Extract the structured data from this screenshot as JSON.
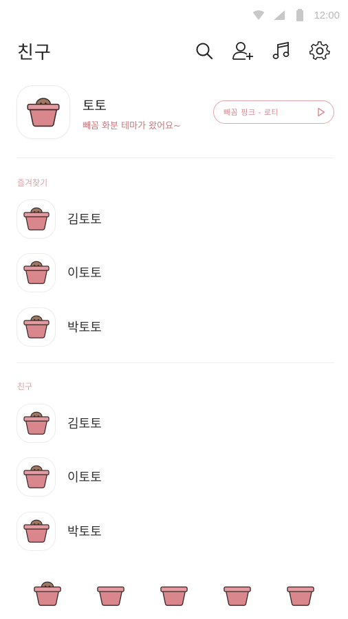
{
  "status_bar": {
    "time": "12:00"
  },
  "header": {
    "title": "친구"
  },
  "profile": {
    "name": "토토",
    "status_message": "빼꼼 화분 테마가 왔어요~",
    "music": "빼꼼 핑크 - 로티"
  },
  "sections": {
    "favorites_label": "즐겨찾기",
    "friends_label": "친구"
  },
  "favorites": [
    {
      "name": "김토토"
    },
    {
      "name": "이토토"
    },
    {
      "name": "박토토"
    }
  ],
  "friends": [
    {
      "name": "김토토"
    },
    {
      "name": "이토토"
    },
    {
      "name": "박토토"
    }
  ],
  "colors": {
    "accent": "#d98a90",
    "pot": "#d9858c",
    "pot_rim": "#e79aa0",
    "head": "#9a7560"
  },
  "bottom_nav": {
    "tabs": [
      "friends-tab",
      "chats-tab",
      "view-tab",
      "shopping-tab",
      "more-tab"
    ]
  }
}
